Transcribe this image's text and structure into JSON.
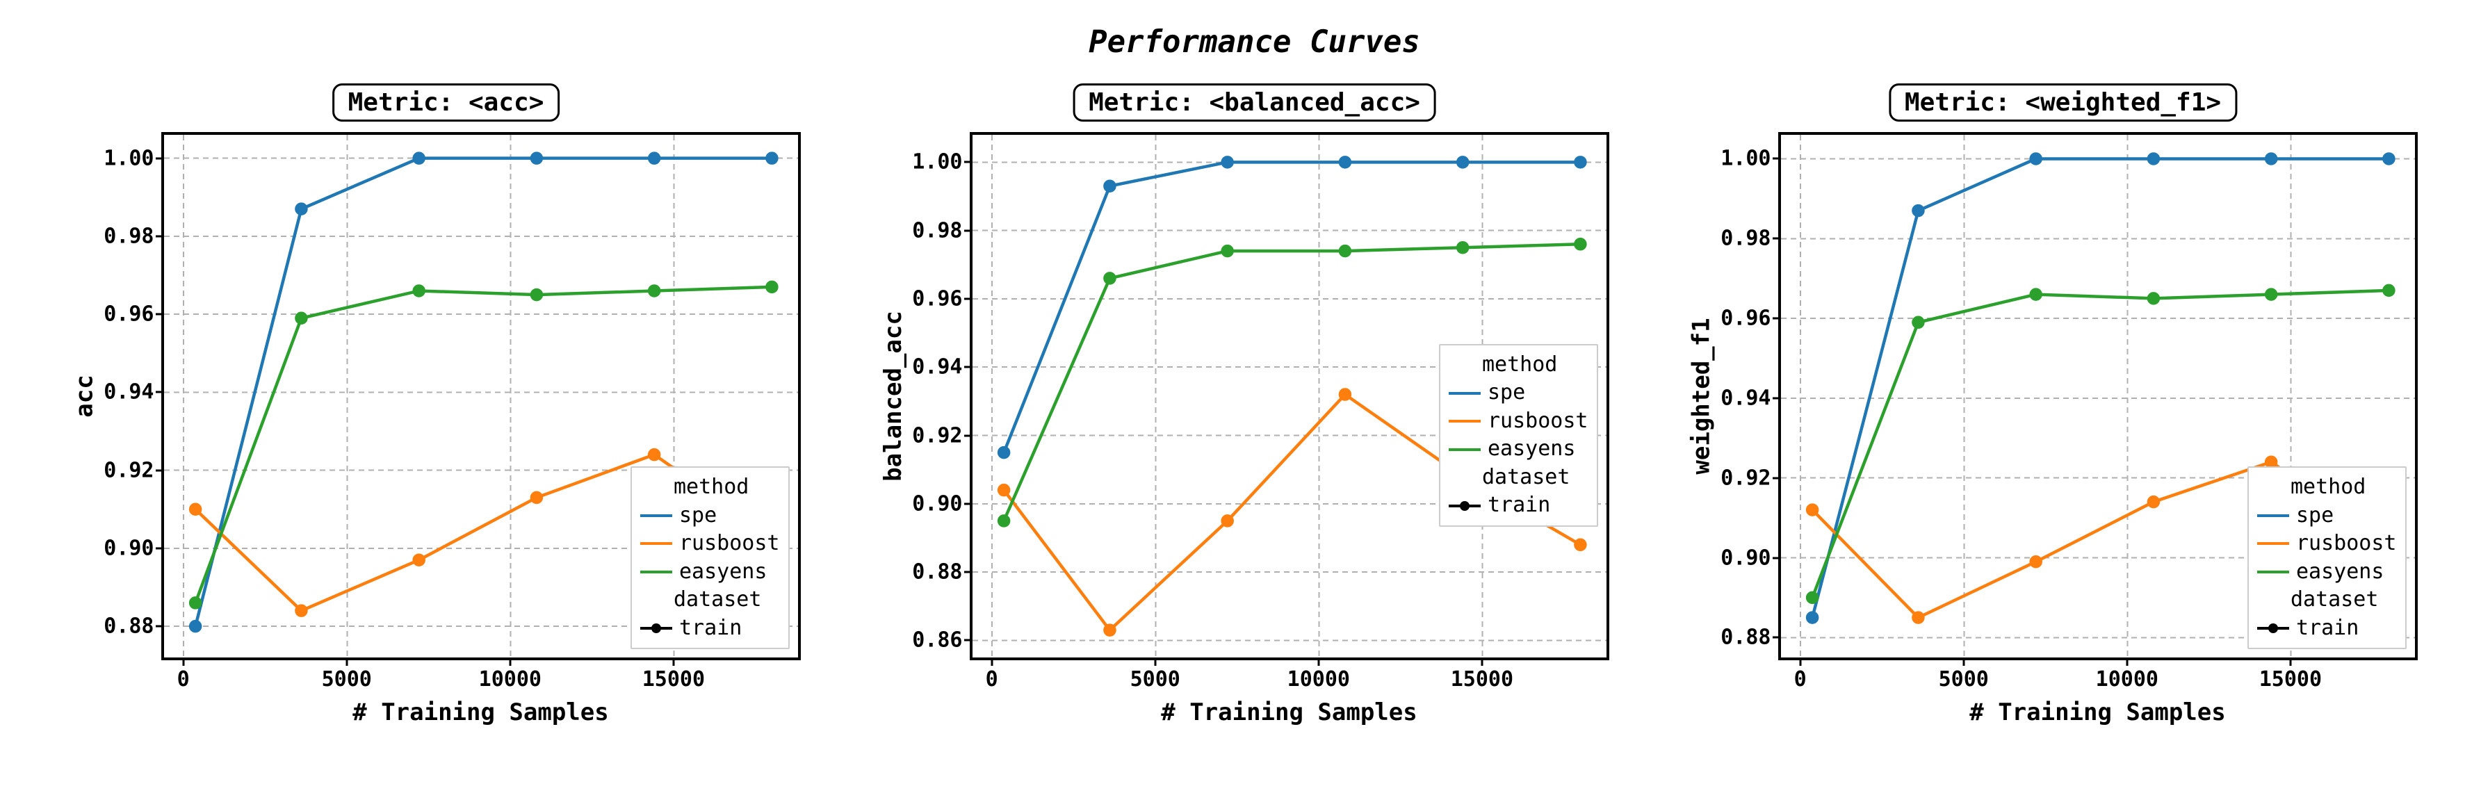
{
  "suptitle": "Performance Curves",
  "xlabel": "# Training Samples",
  "colors": {
    "spe": "#1f77b4",
    "rusboost": "#ff7f0e",
    "easyens": "#2ca02c",
    "train": "#000000"
  },
  "legend": {
    "title_method": "method",
    "items_method": [
      "spe",
      "rusboost",
      "easyens"
    ],
    "title_dataset": "dataset",
    "items_dataset": [
      "train"
    ]
  },
  "chart_data": [
    {
      "id": "acc",
      "title": "Metric: <acc>",
      "ylabel": "acc",
      "type": "line",
      "x": [
        360,
        3600,
        7200,
        10800,
        14400,
        18000
      ],
      "xticks": [
        0,
        5000,
        10000,
        15000
      ],
      "yticks": [
        0.88,
        0.9,
        0.92,
        0.94,
        0.96,
        0.98,
        1.0
      ],
      "ylim": [
        0.872,
        1.006
      ],
      "xlim": [
        -600,
        18800
      ],
      "legend_pos": "lower-right",
      "series": [
        {
          "name": "spe",
          "values": [
            0.88,
            0.987,
            1.0,
            1.0,
            1.0,
            1.0
          ]
        },
        {
          "name": "rusboost",
          "values": [
            0.91,
            0.884,
            0.897,
            0.913,
            0.924,
            0.903
          ]
        },
        {
          "name": "easyens",
          "values": [
            0.886,
            0.959,
            0.966,
            0.965,
            0.966,
            0.967
          ]
        }
      ]
    },
    {
      "id": "balanced_acc",
      "title": "Metric: <balanced_acc>",
      "ylabel": "balanced_acc",
      "type": "line",
      "x": [
        360,
        3600,
        7200,
        10800,
        14400,
        18000
      ],
      "xticks": [
        0,
        5000,
        10000,
        15000
      ],
      "yticks": [
        0.86,
        0.88,
        0.9,
        0.92,
        0.94,
        0.96,
        0.98,
        1.0
      ],
      "ylim": [
        0.855,
        1.008
      ],
      "xlim": [
        -600,
        18800
      ],
      "legend_pos": "mid-right",
      "series": [
        {
          "name": "spe",
          "values": [
            0.915,
            0.993,
            1.0,
            1.0,
            1.0,
            1.0
          ]
        },
        {
          "name": "rusboost",
          "values": [
            0.904,
            0.863,
            0.895,
            0.932,
            0.908,
            0.888
          ]
        },
        {
          "name": "easyens",
          "values": [
            0.895,
            0.966,
            0.974,
            0.974,
            0.975,
            0.976
          ]
        }
      ]
    },
    {
      "id": "weighted_f1",
      "title": "Metric: <weighted_f1>",
      "ylabel": "weighted_f1",
      "type": "line",
      "x": [
        360,
        3600,
        7200,
        10800,
        14400,
        18000
      ],
      "xticks": [
        0,
        5000,
        10000,
        15000
      ],
      "yticks": [
        0.88,
        0.9,
        0.92,
        0.94,
        0.96,
        0.98,
        1.0
      ],
      "ylim": [
        0.875,
        1.006
      ],
      "xlim": [
        -600,
        18800
      ],
      "legend_pos": "lower-right",
      "series": [
        {
          "name": "spe",
          "values": [
            0.885,
            0.987,
            1.0,
            1.0,
            1.0,
            1.0
          ]
        },
        {
          "name": "rusboost",
          "values": [
            0.912,
            0.885,
            0.899,
            0.914,
            0.924,
            0.904
          ]
        },
        {
          "name": "easyens",
          "values": [
            0.89,
            0.959,
            0.966,
            0.965,
            0.966,
            0.967
          ]
        }
      ]
    }
  ]
}
